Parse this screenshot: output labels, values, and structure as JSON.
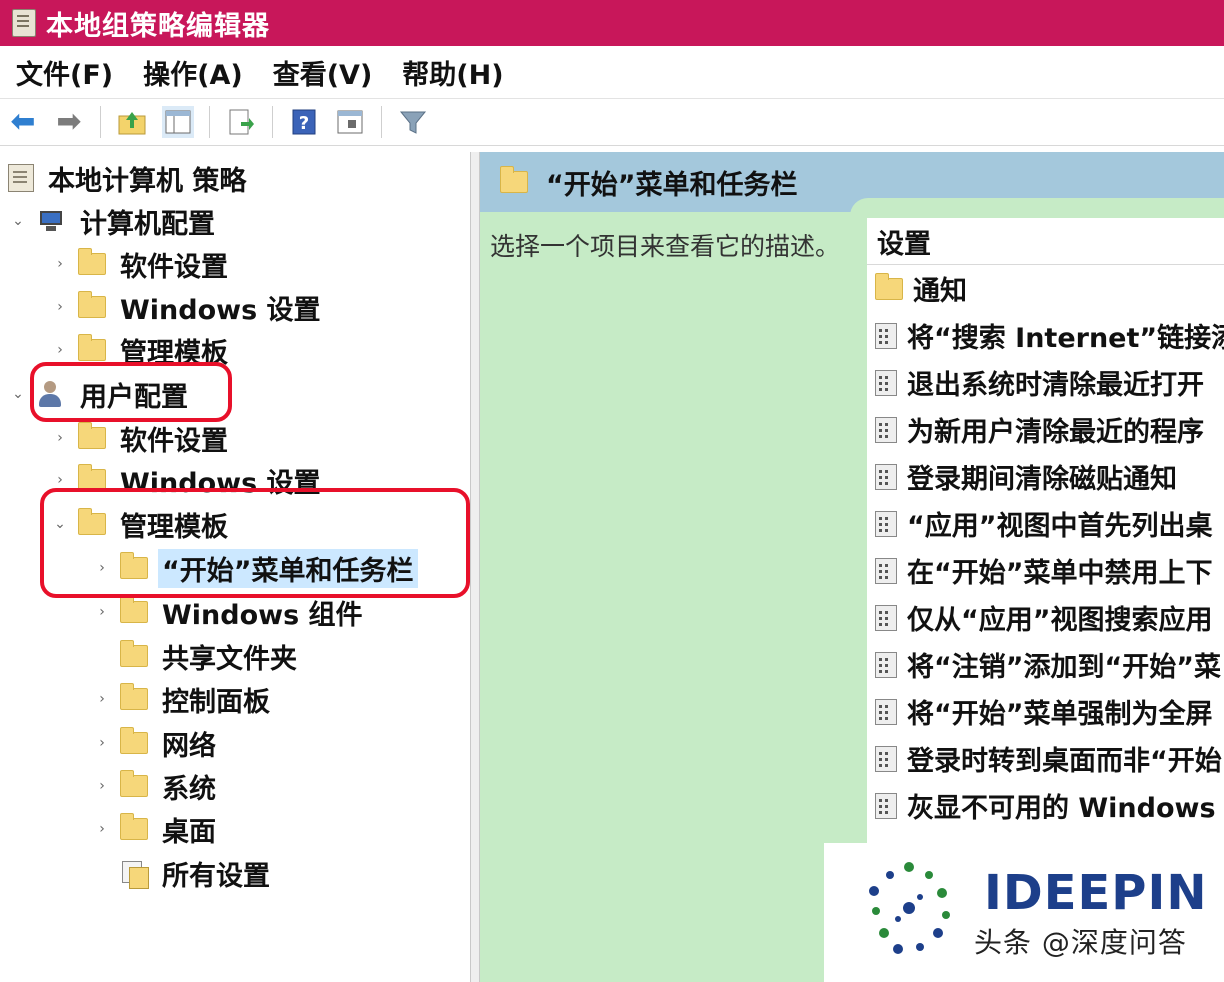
{
  "window": {
    "title": "本地组策略编辑器"
  },
  "menu": [
    "文件(F)",
    "操作(A)",
    "查看(V)",
    "帮助(H)"
  ],
  "toolbar": {
    "icons": [
      "back-icon",
      "forward-icon",
      "up-folder-icon",
      "show-hide-tree-icon",
      "export-list-icon",
      "help-icon",
      "view-icon",
      "filter-icon"
    ]
  },
  "tree": {
    "root": "本地计算机 策略",
    "computer_config": "计算机配置",
    "cc_software": "软件设置",
    "cc_windows": "Windows 设置",
    "cc_admin": "管理模板",
    "user_config": "用户配置",
    "uc_software": "软件设置",
    "uc_windows": "Windows 设置",
    "uc_admin": "管理模板",
    "start_taskbar": "“开始”菜单和任务栏",
    "windows_components": "Windows 组件",
    "shared_folders": "共享文件夹",
    "control_panel": "控制面板",
    "network": "网络",
    "system": "系统",
    "desktop": "桌面",
    "all_settings": "所有设置"
  },
  "detail": {
    "header": "“开始”菜单和任务栏",
    "description": "选择一个项目来查看它的描述。",
    "settings_header": "设置",
    "items": [
      {
        "icon": "folder",
        "label": "通知"
      },
      {
        "icon": "setting",
        "label": "将“搜索 Internet”链接添"
      },
      {
        "icon": "setting",
        "label": "退出系统时清除最近打开"
      },
      {
        "icon": "setting",
        "label": "为新用户清除最近的程序"
      },
      {
        "icon": "setting",
        "label": "登录期间清除磁贴通知"
      },
      {
        "icon": "setting",
        "label": "“应用”视图中首先列出桌"
      },
      {
        "icon": "setting",
        "label": "在“开始”菜单中禁用上下"
      },
      {
        "icon": "setting",
        "label": "仅从“应用”视图搜索应用"
      },
      {
        "icon": "setting",
        "label": "将“注销”添加到“开始”菜"
      },
      {
        "icon": "setting",
        "label": "将“开始”菜单强制为全屏"
      },
      {
        "icon": "setting",
        "label": "登录时转到桌面而非“开始"
      },
      {
        "icon": "setting",
        "label": "灰显不可用的 Windows"
      }
    ]
  },
  "watermark": {
    "brand": "IDEEPIN",
    "sub": "头条 @深度问答"
  },
  "colors": {
    "titlebar": "#c8175a",
    "highlight": "#e8102a",
    "pane": "#c6ebc6",
    "header": "#a4c8dc"
  }
}
